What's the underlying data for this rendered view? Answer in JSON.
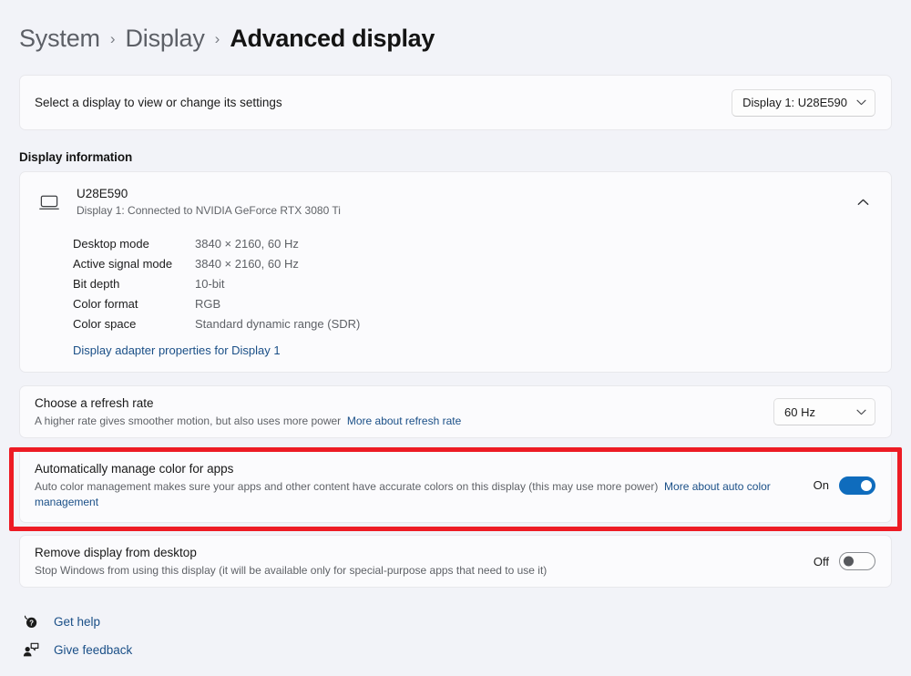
{
  "breadcrumb": {
    "items": [
      {
        "label": "System",
        "current": false
      },
      {
        "label": "Display",
        "current": false
      },
      {
        "label": "Advanced display",
        "current": true
      }
    ],
    "separator": "›"
  },
  "select_display": {
    "label": "Select a display to view or change its settings",
    "dropdown_value": "Display 1: U28E590"
  },
  "display_information": {
    "heading": "Display information",
    "monitor_name": "U28E590",
    "monitor_sub": "Display 1: Connected to NVIDIA GeForce RTX 3080 Ti",
    "expanded": true,
    "specs": [
      {
        "key": "Desktop mode",
        "value": "3840 × 2160, 60 Hz"
      },
      {
        "key": "Active signal mode",
        "value": "3840 × 2160, 60 Hz"
      },
      {
        "key": "Bit depth",
        "value": "10-bit"
      },
      {
        "key": "Color format",
        "value": "RGB"
      },
      {
        "key": "Color space",
        "value": "Standard dynamic range (SDR)"
      }
    ],
    "adapter_link": "Display adapter properties for Display 1"
  },
  "refresh_rate": {
    "title": "Choose a refresh rate",
    "desc": "A higher rate gives smoother motion, but also uses more power",
    "link": "More about refresh rate",
    "dropdown_value": "60 Hz"
  },
  "auto_color": {
    "title": "Automatically manage color for apps",
    "desc": "Auto color management makes sure your apps and other content have accurate colors on this display (this may use more power)",
    "link": "More about auto color management",
    "toggle_label": "On",
    "toggle_state": "on"
  },
  "remove_display": {
    "title": "Remove display from desktop",
    "desc": "Stop Windows from using this display (it will be available only for special-purpose apps that need to use it)",
    "toggle_label": "Off",
    "toggle_state": "off"
  },
  "footer": {
    "get_help": "Get help",
    "give_feedback": "Give feedback"
  },
  "colors": {
    "accent": "#0f6cbd",
    "link": "#1a4f87",
    "highlight": "#ed1b24",
    "page_background": "#f2f3f8",
    "card_background": "#fbfbfd"
  }
}
